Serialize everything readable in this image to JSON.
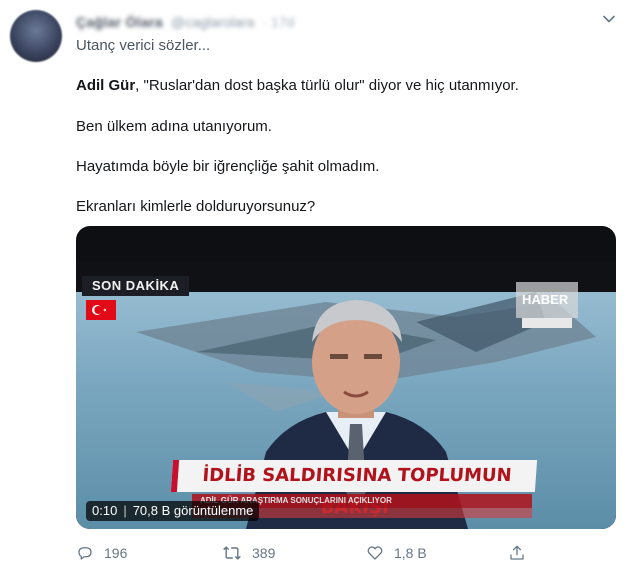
{
  "tweet": {
    "author": {
      "display_name": "Çağlar Ölara",
      "handle": "@caglarolara",
      "time": "· 17d"
    },
    "text_lines": [
      "Utanç verici sözler...",
      "Ben ülkem adına utanıyorum.",
      "Hayatımda böyle bir iğrençliğe şahit olmadım.",
      "Ekranları kimlerle dolduruyorsunuz?"
    ],
    "quote_line": {
      "bold_name": "Adil Gür",
      "rest": ", \"Ruslar'dan dost başka türlü olur\" diyor ve hiç utanmıyor."
    },
    "media": {
      "tv_logo": "SON DAKİKA",
      "channel": "HABER",
      "lower_third": "İDLİB SALDIRISINA TOPLUMUN BAKIŞI",
      "ticker": "ADİL GÜR ARAŞTIRMA SONUÇLARINI AÇIKLIYOR",
      "video_time": "0:10",
      "separator": "|",
      "views": "70,8 B görüntülenme"
    },
    "actions": {
      "replies": "196",
      "retweets": "389",
      "likes": "1,8 B"
    },
    "icons": {
      "caret": "chevron-down-icon",
      "reply": "reply-icon",
      "retweet": "retweet-icon",
      "like": "heart-icon",
      "share": "share-icon"
    },
    "colors": {
      "text": "#14171a",
      "secondary": "#657786",
      "lower_third_red": "#b1121b"
    }
  }
}
